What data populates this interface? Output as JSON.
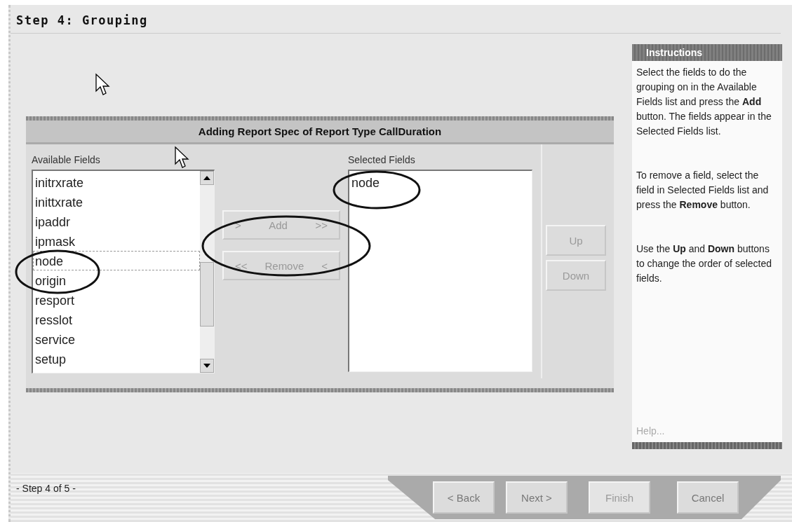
{
  "title": "Step 4: Grouping",
  "dialog": {
    "heading": "Adding Report Spec of Report Type CallDuration",
    "available": {
      "label": "Available Fields",
      "items": [
        {
          "text": "initrxrate",
          "focused": false
        },
        {
          "text": "inittxrate",
          "focused": false
        },
        {
          "text": "ipaddr",
          "focused": false
        },
        {
          "text": "ipmask",
          "focused": false
        },
        {
          "text": "node",
          "focused": true
        },
        {
          "text": "origin",
          "focused": false
        },
        {
          "text": "resport",
          "focused": false
        },
        {
          "text": "resslot",
          "focused": false
        },
        {
          "text": "service",
          "focused": false
        },
        {
          "text": "setup",
          "focused": false
        }
      ]
    },
    "move_buttons": [
      {
        "left": ">",
        "label": "Add",
        "right": ">>"
      },
      {
        "left": "<<",
        "label": "Remove",
        "right": "<"
      }
    ],
    "selected": {
      "label": "Selected Fields",
      "items": [
        "node"
      ]
    },
    "order_buttons": [
      "Up",
      "Down"
    ]
  },
  "instructions": {
    "title": "Instructions",
    "paragraphs": [
      "Select the fields to do the grouping on in the Available Fields list and press the **Add** button. The fields appear in the Selected Fields list.",
      "To remove a field, select the field in Selected Fields list and press the **Remove** button.",
      "Use the **Up** and **Down** buttons to change the order of selected fields."
    ],
    "help": "Help..."
  },
  "footer": {
    "step": "- Step 4 of 5 -",
    "buttons": [
      {
        "label": "< Back",
        "disabled": false
      },
      {
        "label": "Next >",
        "disabled": false
      },
      {
        "label": "Finish",
        "disabled": true
      },
      {
        "label": "Cancel",
        "disabled": false
      }
    ]
  }
}
